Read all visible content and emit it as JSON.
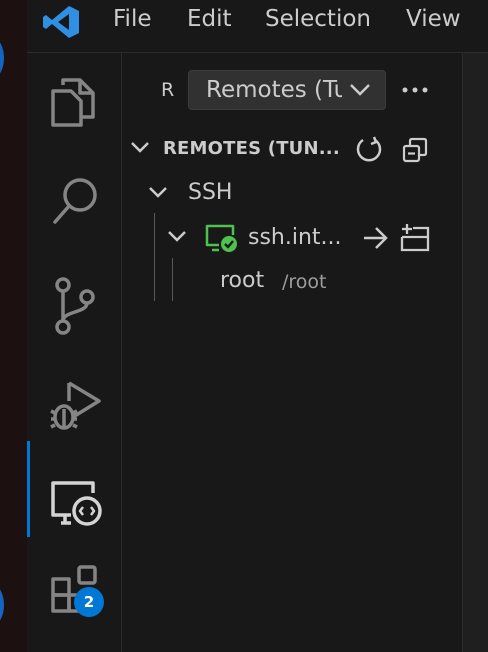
{
  "menu": {
    "file": "File",
    "edit": "Edit",
    "selection": "Selection",
    "view": "View"
  },
  "activity_bar": {
    "items": [
      "explorer-icon",
      "search-icon",
      "source-control-icon",
      "run-debug-icon",
      "remote-explorer-icon",
      "extensions-icon"
    ],
    "active": "remote-explorer-icon",
    "extensions_badge": "2"
  },
  "sidebar": {
    "header_letter": "R",
    "dropdown_value": "Remotes (Tunnels/SSH)",
    "section_title": "REMOTES (TUN...",
    "tree": {
      "group_label": "SSH",
      "host_label": "ssh.int...",
      "folder_name": "root",
      "folder_path": "/root"
    }
  },
  "colors": {
    "accent": "#0078d4",
    "vscode_blue": "#2f8fe3",
    "connected_green": "#4ec24e"
  }
}
